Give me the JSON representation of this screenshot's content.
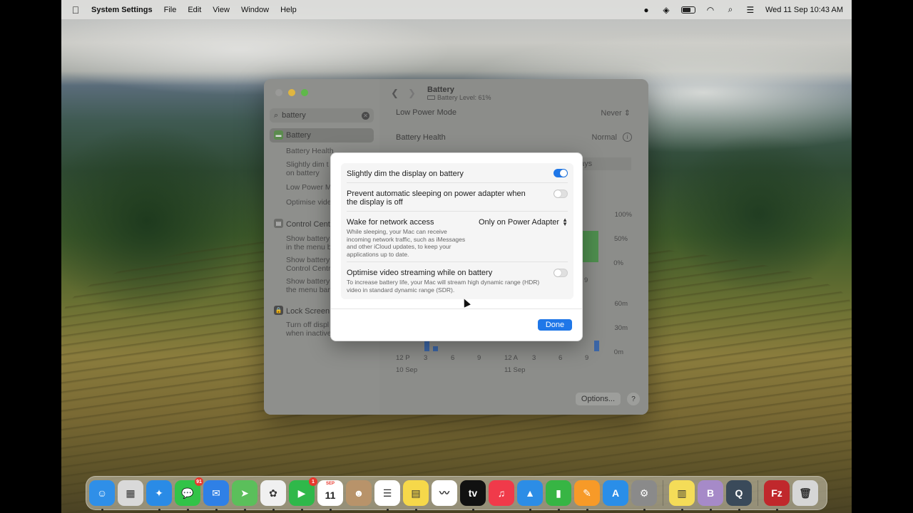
{
  "menubar": {
    "app_name": "System Settings",
    "menus": [
      "File",
      "Edit",
      "View",
      "Window",
      "Help"
    ],
    "datetime": "Wed 11 Sep  10:43 AM"
  },
  "sidebar": {
    "search_value": "battery",
    "items": [
      {
        "label": "Battery",
        "selected": true
      },
      {
        "label": "Battery Health"
      },
      {
        "label": "Slightly dim t",
        "label2": "on battery"
      },
      {
        "label": "Low Power Mo"
      },
      {
        "label": "Optimise vide"
      },
      {
        "label": "Control Centr"
      },
      {
        "label": "Show battery",
        "label2": "in the menu ba"
      },
      {
        "label": "Show battery",
        "label2": "Control Centr"
      },
      {
        "label": "Show battery",
        "label2": "the menu bar"
      },
      {
        "label": "Lock Screen"
      },
      {
        "label": "Turn off displ",
        "label2": "when inactive"
      }
    ]
  },
  "content": {
    "title": "Battery",
    "subtitle": "Battery Level: 61%",
    "low_power_label": "Low Power Mode",
    "low_power_value": "Never",
    "battery_health_label": "Battery Health",
    "battery_health_value": "Normal",
    "tab_fragment": "ays",
    "chart": {
      "level_ticks": [
        "100%",
        "50%",
        "0%"
      ],
      "usage_ticks": [
        "60m",
        "30m",
        "0m"
      ],
      "x_left": [
        "12 P",
        "3",
        "6",
        "9"
      ],
      "x_right": [
        "12 A",
        "3",
        "6",
        "9"
      ],
      "date_left": "10 Sep",
      "date_right": "11 Sep",
      "level_x_fragment": "9"
    },
    "options_label": "Options...",
    "help_label": "?"
  },
  "sheet": {
    "rows": [
      {
        "title": "Slightly dim the display on battery",
        "toggle": true
      },
      {
        "title": "Prevent automatic sleeping on power adapter when the display is off",
        "toggle": false
      },
      {
        "title": "Wake for network access",
        "desc": "While sleeping, your Mac can receive incoming network traffic, such as iMessages and other iCloud updates, to keep your applications up to date.",
        "select": "Only on Power Adapter"
      },
      {
        "title": "Optimise video streaming while on battery",
        "desc": "To increase battery life, your Mac will stream high dynamic range (HDR) video in standard dynamic range (SDR).",
        "toggle": false
      }
    ],
    "done_label": "Done"
  },
  "dock": {
    "apps": [
      {
        "name": "Finder",
        "color": "#2f8fe8",
        "glyph": "☺"
      },
      {
        "name": "Launchpad",
        "color": "#d9d9d9",
        "glyph": "▦"
      },
      {
        "name": "Safari",
        "color": "#2a8be6",
        "glyph": "✦"
      },
      {
        "name": "Messages",
        "color": "#32c348",
        "glyph": "💬",
        "badge": "91"
      },
      {
        "name": "Mail",
        "color": "#2f80e6",
        "glyph": "✉"
      },
      {
        "name": "Maps",
        "color": "#5bbf5b",
        "glyph": "➤"
      },
      {
        "name": "Photos",
        "color": "#f0f0f0",
        "glyph": "✿"
      },
      {
        "name": "FaceTime",
        "color": "#2fb84a",
        "glyph": "▶",
        "badge": "1"
      },
      {
        "name": "Calendar",
        "color": "#ffffff",
        "glyph": "11",
        "small": "SEP"
      },
      {
        "name": "Contacts",
        "color": "#b8936a",
        "glyph": "☻"
      },
      {
        "name": "Reminders",
        "color": "#ffffff",
        "glyph": "☰"
      },
      {
        "name": "Notes",
        "color": "#f6d84a",
        "glyph": "▤"
      },
      {
        "name": "Freeform",
        "color": "#ffffff",
        "glyph": "〰"
      },
      {
        "name": "Apple TV",
        "color": "#111111",
        "glyph": "tv"
      },
      {
        "name": "Music",
        "color": "#f03a4a",
        "glyph": "♫"
      },
      {
        "name": "Keynote",
        "color": "#2c8de6",
        "glyph": "▲"
      },
      {
        "name": "Numbers",
        "color": "#37b544",
        "glyph": "▮"
      },
      {
        "name": "Pages",
        "color": "#f79a28",
        "glyph": "✎"
      },
      {
        "name": "App Store",
        "color": "#2a8ee8",
        "glyph": "A"
      },
      {
        "name": "System Settings",
        "color": "#8a8a8a",
        "glyph": "⚙"
      },
      {
        "name": "Stickies",
        "color": "#f4dc58",
        "glyph": "▥"
      },
      {
        "name": "BBEdit",
        "color": "#a68ac8",
        "glyph": "B"
      },
      {
        "name": "QuickTime",
        "color": "#3a4a5a",
        "glyph": "Q"
      },
      {
        "name": "FileZilla",
        "color": "#c0282c",
        "glyph": "Fz"
      },
      {
        "name": "Trash",
        "color": "#d6d6d6",
        "glyph": "🗑"
      }
    ]
  }
}
